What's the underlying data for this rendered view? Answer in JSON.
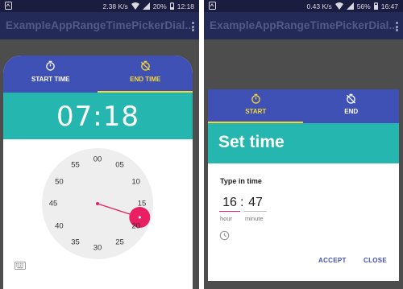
{
  "left": {
    "status": {
      "speed": "2.38 K/s",
      "battery": "20%",
      "time": "12:18"
    },
    "app_title": "ExampleAppRangeTimePickerDial...",
    "tabs": [
      {
        "label": "START TIME",
        "icon": "stopwatch-icon",
        "active": false
      },
      {
        "label": "END TIME",
        "icon": "timer-off-icon",
        "active": true
      }
    ],
    "time_display": "07:18",
    "clock": {
      "numbers": [
        "00",
        "05",
        "10",
        "15",
        "20",
        "25",
        "30",
        "35",
        "40",
        "45",
        "50",
        "55"
      ],
      "selected_minute": 18
    },
    "keyboard_icon": "keyboard-icon"
  },
  "right": {
    "status": {
      "speed": "0.43 K/s",
      "battery": "56%",
      "time": "16:47"
    },
    "app_title": "ExampleAppRangeTimePickerDial...",
    "tabs": [
      {
        "label": "START",
        "icon": "stopwatch-icon",
        "active": true
      },
      {
        "label": "END",
        "icon": "timer-off-icon",
        "active": false
      }
    ],
    "header_title": "Set time",
    "type_label": "Type in time",
    "hour_value": "16",
    "minute_value": "47",
    "hour_caption": "hour",
    "minute_caption": "minute",
    "clock_icon": "clock-icon",
    "accept_label": "ACCEPT",
    "close_label": "CLOSE"
  },
  "colors": {
    "indigo": "#3f51b5",
    "teal": "#26b6b0",
    "yellow_accent": "#f7d72d",
    "pink_accent": "#e91e63",
    "appbar": "#232a58"
  }
}
